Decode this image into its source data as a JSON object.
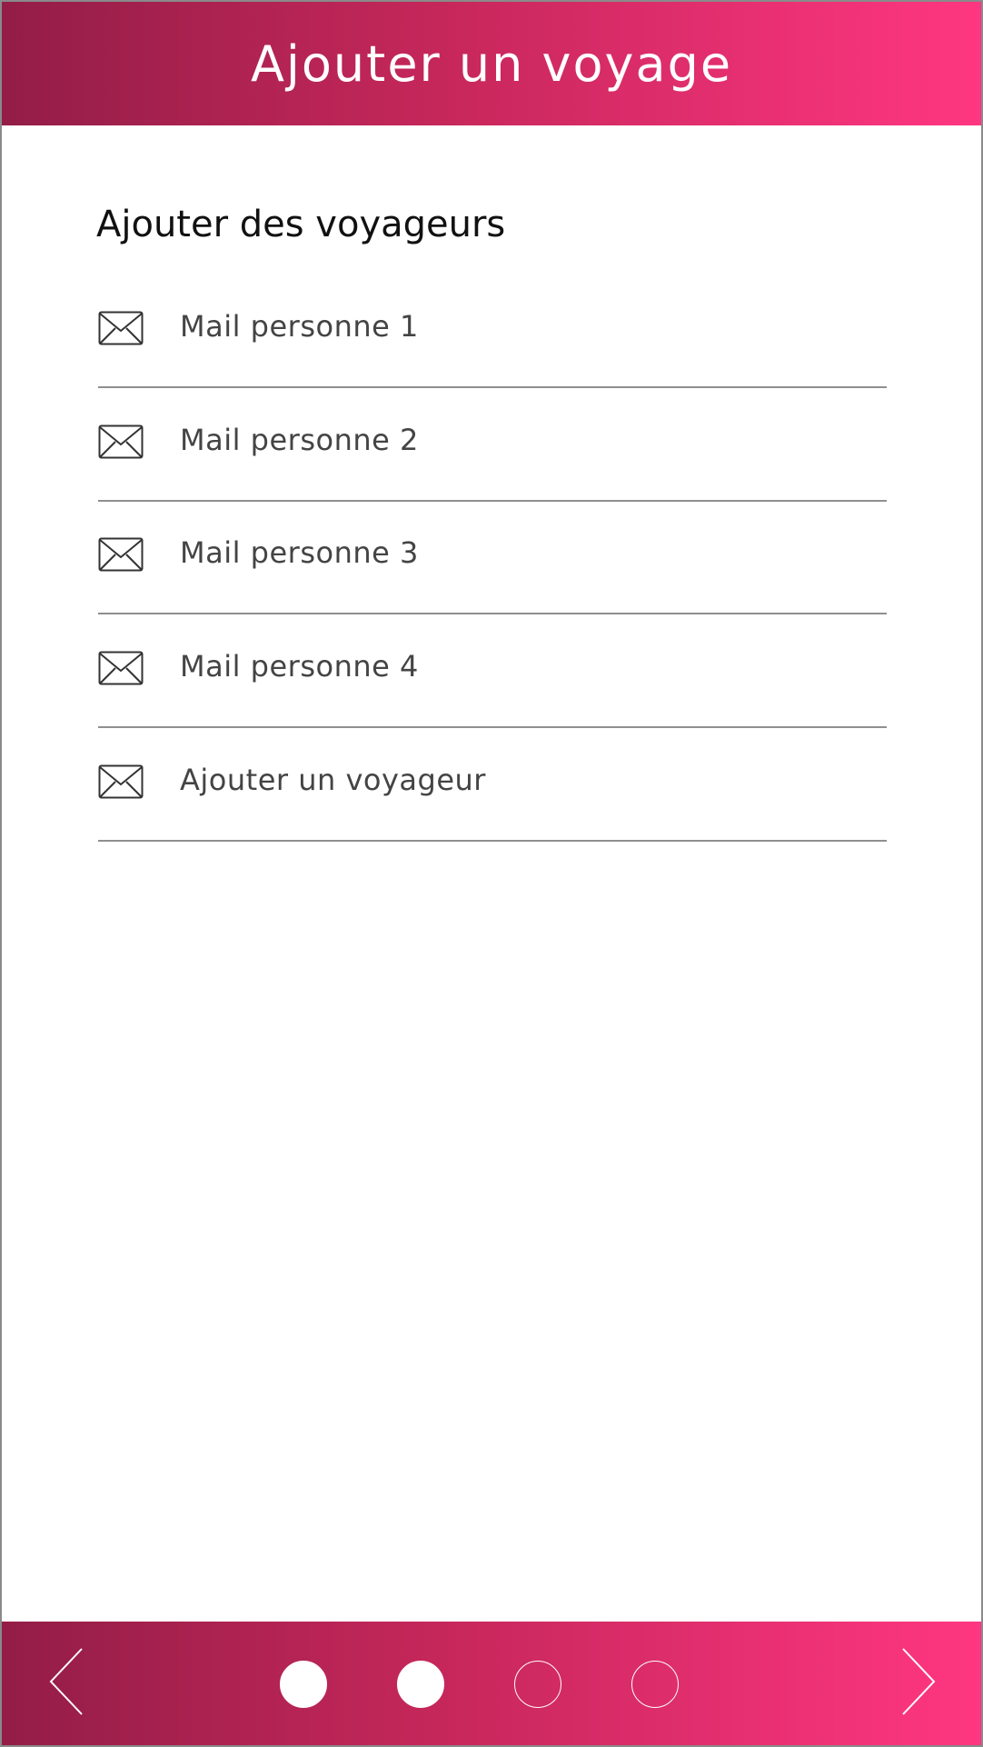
{
  "header": {
    "title": "Ajouter un voyage"
  },
  "section": {
    "title": "Ajouter des voyageurs"
  },
  "fields": [
    {
      "placeholder": "Mail personne 1",
      "icon": "mail-icon"
    },
    {
      "placeholder": "Mail personne 2",
      "icon": "mail-icon"
    },
    {
      "placeholder": "Mail personne 3",
      "icon": "mail-icon"
    },
    {
      "placeholder": "Mail personne 4",
      "icon": "mail-icon"
    },
    {
      "placeholder": "Ajouter un voyageur",
      "icon": "mail-icon"
    }
  ],
  "pagination": {
    "total_steps": 4,
    "completed_steps": 2,
    "prev_icon": "chevron-left-icon",
    "next_icon": "chevron-right-icon"
  },
  "colors": {
    "gradient_start": "#931d47",
    "gradient_end": "#ff3681",
    "divider": "#8f8f8f"
  }
}
